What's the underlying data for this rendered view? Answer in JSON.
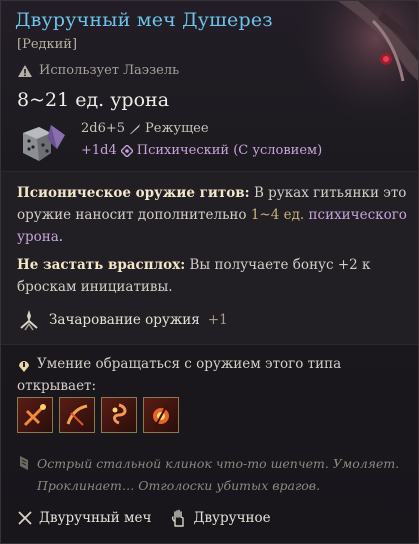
{
  "item": {
    "title": "Двуручный меч Душерез",
    "rarity": "[Редкий]",
    "uses": "Использует Лаэзель",
    "damage": "8~21 ед. урона",
    "dice_base": "2d6+5",
    "dice_type": "Режущее",
    "dice_bonus": "+1d4",
    "dice_bonus_type": "Психический (С условием)"
  },
  "description": {
    "p1_bold": "Псионическое оружие гитов:",
    "p1_text_a": " В руках гитьянки это оружие наносит дополнительно ",
    "p1_value": "1~4 ед.",
    "p1_text_b": "",
    "p1_purple": "психического урона",
    "p1_end": ".",
    "p2_bold": "Не застать врасплох:",
    "p2_text": " Вы получаете бонус +2 к броскам инициативы.",
    "enchant_label": "Зачарование оружия",
    "enchant_value": "+1"
  },
  "proficiency": {
    "text": "Умение обращаться с оружием этого типа открывает:"
  },
  "flavor": "Острый стальной клинок что-то шепчет. Умоляет. Проклинает… Отголоски убитых врагов.",
  "footer": {
    "weapon_type": "Двуручный меч",
    "handedness": "Двуручное"
  },
  "colors": {
    "title": "#6ec3e8",
    "psychic": "#c7a4dc",
    "highlight": "#c7b27a"
  },
  "icons": [
    "warning-icon",
    "dice-icon",
    "slashing-icon",
    "psychic-icon",
    "enchantment-icon",
    "proficiency-icon",
    "action-icon-1",
    "action-icon-2",
    "action-icon-3",
    "action-icon-4",
    "flavor-icon",
    "greatsword-icon",
    "two-handed-icon"
  ]
}
